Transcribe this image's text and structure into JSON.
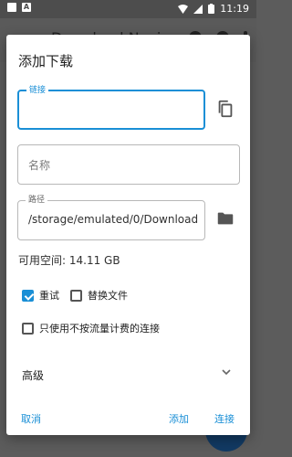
{
  "status_bar": {
    "time": "11:19",
    "notification_letter": "A"
  },
  "background": {
    "app_title": "Download Navi"
  },
  "dialog": {
    "title": "添加下载",
    "link_field": {
      "label": "链接",
      "value": ""
    },
    "name_field": {
      "placeholder": "名称",
      "value": ""
    },
    "path_field": {
      "label": "路径",
      "value": "/storage/emulated/0/Download"
    },
    "free_space": "可用空间: 14.11 GB",
    "options": {
      "retry_label": "重试",
      "retry_checked": true,
      "replace_label": "替换文件",
      "replace_checked": false,
      "unmetered_label": "只使用不按流量计费的连接",
      "unmetered_checked": false
    },
    "advanced_label": "高级",
    "buttons": {
      "cancel": "取消",
      "add": "添加",
      "connect": "连接"
    }
  },
  "colors": {
    "accent": "#1a8fd6",
    "fab": "#123a63"
  },
  "icons": [
    "copy-icon",
    "folder-icon",
    "chevron-down-icon",
    "search-icon",
    "theme-icon",
    "more-icon"
  ]
}
